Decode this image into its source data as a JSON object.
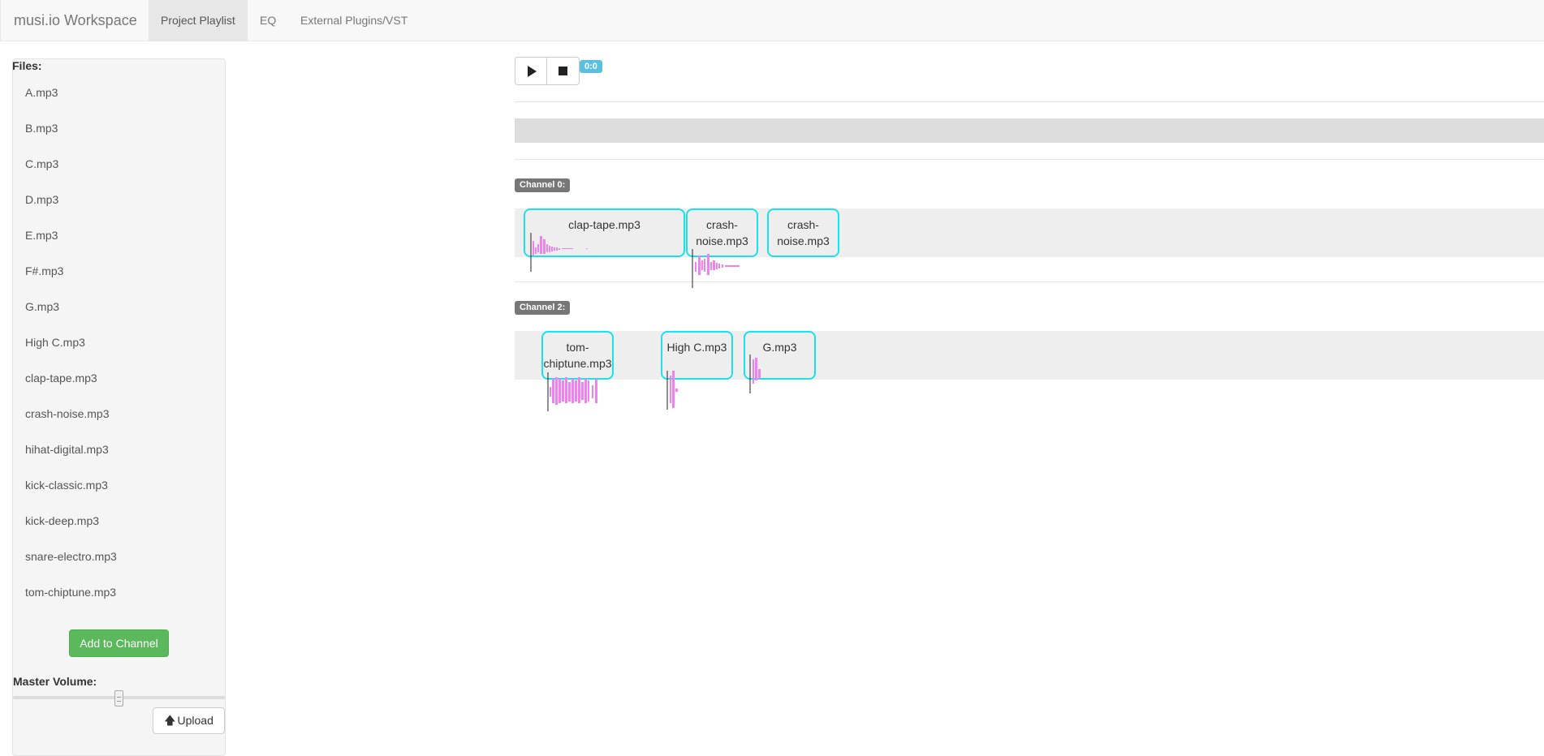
{
  "app": {
    "brand": "musi.io Workspace"
  },
  "nav": {
    "tabs": [
      "Project Playlist",
      "EQ",
      "External Plugins/VST"
    ],
    "active": 0
  },
  "sidebar": {
    "files_title": "Files:",
    "files": [
      "A.mp3",
      "B.mp3",
      "C.mp3",
      "D.mp3",
      "E.mp3",
      "F#.mp3",
      "G.mp3",
      "High C.mp3",
      "clap-tape.mp3",
      "crash-noise.mp3",
      "hihat-digital.mp3",
      "kick-classic.mp3",
      "kick-deep.mp3",
      "snare-electro.mp3",
      "tom-chiptune.mp3"
    ],
    "add_button": "Add to Channel",
    "master_volume_label": "Master Volume:",
    "master_volume": 0.5,
    "upload_button": "Upload"
  },
  "transport": {
    "time": "0:0"
  },
  "channels": [
    {
      "label": "Channel 0:",
      "clips": [
        "clap-tape.mp3",
        "crash-noise.mp3",
        "crash-noise.mp3"
      ]
    },
    {
      "label": "Channel 2:",
      "clips": [
        "tom-chiptune.mp3",
        "High C.mp3",
        "G.mp3"
      ]
    }
  ],
  "colors": {
    "clip_border": "#19e1f0",
    "waveform": "#ee82ee",
    "add_button": "#5cb85c",
    "time_badge": "#5bc0de",
    "channel_label": "#777777"
  }
}
